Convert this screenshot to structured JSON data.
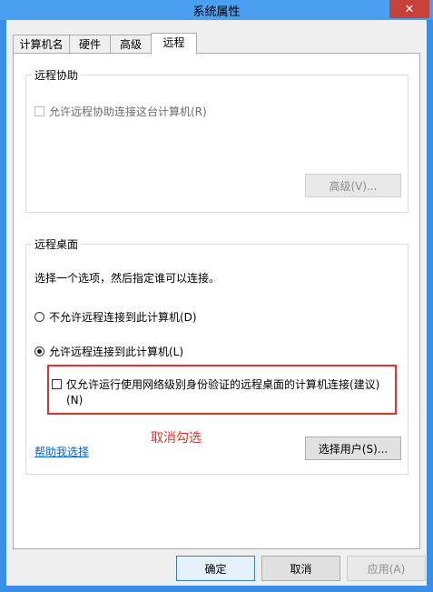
{
  "window": {
    "title": "系统属性",
    "close_glyph": "✕"
  },
  "tabs": [
    {
      "label": "计算机名"
    },
    {
      "label": "硬件"
    },
    {
      "label": "高级"
    },
    {
      "label": "远程"
    }
  ],
  "remote_assistance": {
    "group_title": "远程协助",
    "allow_checkbox_label": "允许远程协助连接这台计算机(R)",
    "allow_checked": false,
    "advanced_button": "高级(V)..."
  },
  "remote_desktop": {
    "group_title": "远程桌面",
    "instruction": "选择一个选项，然后指定谁可以连接。",
    "option_deny": "不允许远程连接到此计算机(D)",
    "option_allow": "允许远程连接到此计算机(L)",
    "selected_option": "allow",
    "nla_checkbox_label_line1": "仅允许运行使用网络级别身份验证的远程桌面的计算机连接(建议)",
    "nla_checkbox_label_line2": "(N)",
    "nla_checked": false,
    "help_link": "帮助我选择",
    "select_users_button": "选择用户(S)..."
  },
  "annotation": {
    "text": "取消勾选",
    "color": "#e0332e"
  },
  "footer": {
    "ok_button": "确定",
    "cancel_button": "取消",
    "apply_button": "应用(A)"
  }
}
